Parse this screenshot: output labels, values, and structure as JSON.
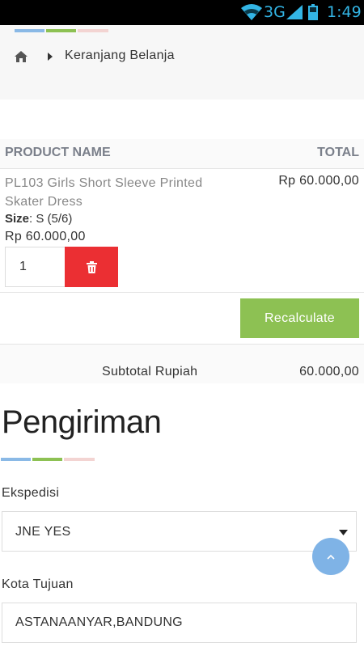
{
  "status_bar": {
    "network": "3G",
    "clock": "1:49"
  },
  "colors": {
    "accent_blue": "#8ab9e6",
    "accent_green": "#8dc153",
    "accent_pink": "#f3d4d2",
    "delete_red": "#eb2f33",
    "scroll_top_blue": "#7fb3e6"
  },
  "breadcrumb": {
    "home_icon": "home-icon",
    "separator_icon": "caret-right-icon",
    "current": "Keranjang Belanja"
  },
  "cart": {
    "columns": {
      "product_name": "PRODUCT NAME",
      "total": "TOTAL"
    },
    "items": [
      {
        "name": "PL103 Girls Short Sleeve Printed Skater Dress",
        "size_label": "Size",
        "size_value": ": S (5/6)",
        "price": "Rp 60.000,00",
        "total": "Rp 60.000,00",
        "quantity": "1",
        "delete_icon": "trash-icon"
      }
    ],
    "recalculate_label": "Recalculate",
    "subtotal_label": "Subtotal Rupiah",
    "subtotal_value": "60.000,00"
  },
  "shipping": {
    "title": "Pengiriman",
    "courier_label": "Ekspedisi",
    "courier_value": "JNE YES",
    "city_label": "Kota Tujuan",
    "city_value": "ASTANAANYAR,BANDUNG"
  },
  "scroll_top_icon": "chevron-up-icon"
}
